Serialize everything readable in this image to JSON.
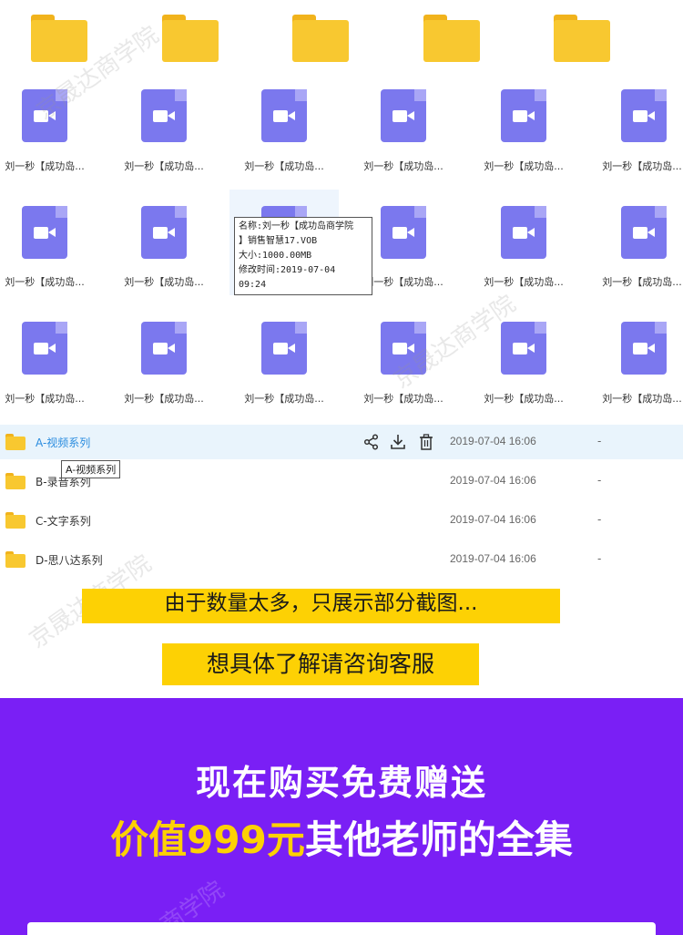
{
  "grid": {
    "folders_count": 5,
    "video_label": "刘一秒【成功岛...",
    "rows": 3,
    "cols": 6
  },
  "tooltip": {
    "name_line1": "名称:刘一秒【成功岛商学院",
    "name_line2": "】销售智慧17.VOB",
    "size": "大小:1000.00MB",
    "modified": "修改时间:2019-07-04 09:24"
  },
  "list": {
    "rows": [
      {
        "name": "A-视频系列",
        "date": "2019-07-04 16:06",
        "size": "-"
      },
      {
        "name": "B-录音系列",
        "date": "2019-07-04 16:06",
        "size": "-"
      },
      {
        "name": "C-文字系列",
        "date": "2019-07-04 16:06",
        "size": "-"
      },
      {
        "name": "D-思八达系列",
        "date": "2019-07-04 16:06",
        "size": "-"
      }
    ],
    "hover_tooltip": "A-视频系列",
    "actions": [
      "share-icon",
      "download-icon",
      "delete-icon"
    ]
  },
  "banners": {
    "line1": "由于数量太多，只展示部分截图...",
    "line2": "想具体了解请咨询客服"
  },
  "promo": {
    "line1": "现在购买免费赠送",
    "highlight": "价值999元",
    "rest": "其他老师的全集"
  },
  "watermark": "京晟达商学院",
  "colors": {
    "folder": "#f8c830",
    "video": "#7b78ee",
    "banner": "#fdd104",
    "promo_bg": "#7a1ff5",
    "active_row": "#e9f4fc",
    "link_blue": "#2a8cdf"
  }
}
